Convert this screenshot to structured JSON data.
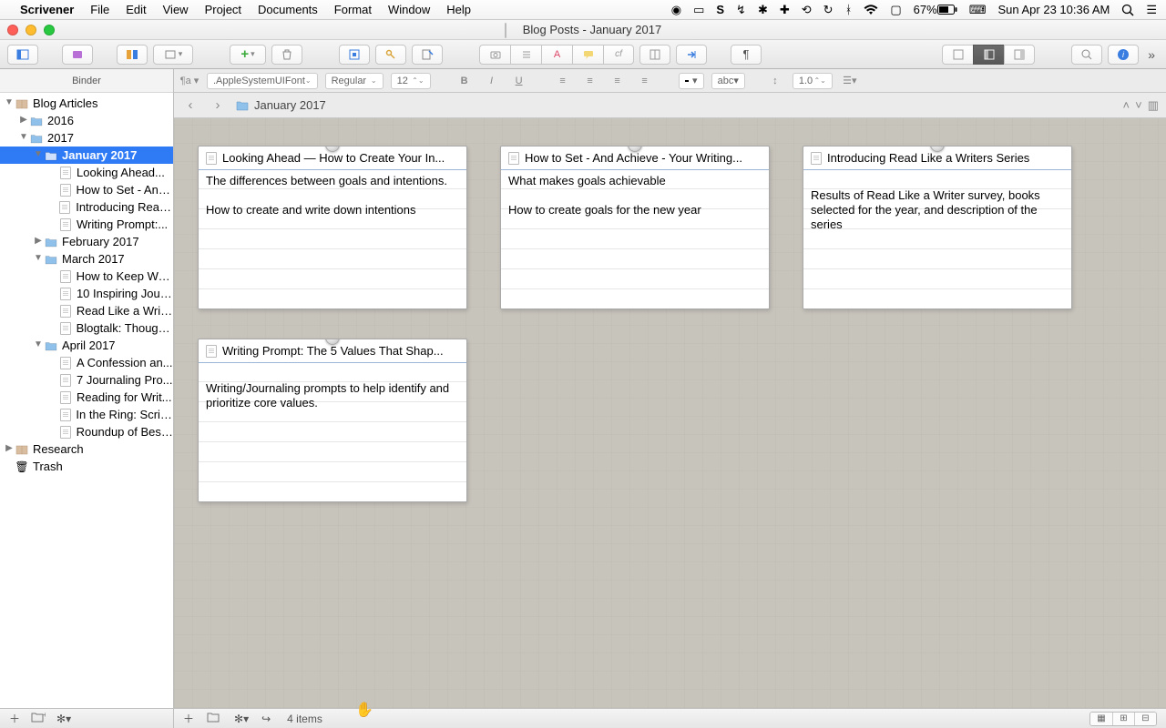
{
  "menubar": {
    "app": "Scrivener",
    "items": [
      "File",
      "Edit",
      "View",
      "Project",
      "Documents",
      "Format",
      "Window",
      "Help"
    ],
    "battery": "67%",
    "datetime": "Sun Apr 23  10:36 AM"
  },
  "window": {
    "title": "Blog Posts - January 2017"
  },
  "formatbar": {
    "font": ".AppleSystemUIFont",
    "style": "Regular",
    "size": "12",
    "spacing": "1.0"
  },
  "binder": {
    "header": "Binder",
    "tree": [
      {
        "type": "folder",
        "label": "Blog Articles",
        "depth": 0,
        "open": true,
        "icon": "box"
      },
      {
        "type": "folder",
        "label": "2016",
        "depth": 1,
        "open": false
      },
      {
        "type": "folder",
        "label": "2017",
        "depth": 1,
        "open": true
      },
      {
        "type": "folder",
        "label": "January 2017",
        "depth": 2,
        "open": true,
        "selected": true
      },
      {
        "type": "doc",
        "label": "Looking Ahead...",
        "depth": 3
      },
      {
        "type": "doc",
        "label": "How to Set - And...",
        "depth": 3
      },
      {
        "type": "doc",
        "label": "Introducing Read...",
        "depth": 3
      },
      {
        "type": "doc",
        "label": "Writing Prompt:...",
        "depth": 3
      },
      {
        "type": "folder",
        "label": "February 2017",
        "depth": 2,
        "open": false
      },
      {
        "type": "folder",
        "label": "March 2017",
        "depth": 2,
        "open": true
      },
      {
        "type": "doc",
        "label": "How to Keep Wri...",
        "depth": 3
      },
      {
        "type": "doc",
        "label": "10 Inspiring Jour...",
        "depth": 3
      },
      {
        "type": "doc",
        "label": "Read Like a Writ...",
        "depth": 3
      },
      {
        "type": "doc",
        "label": "Blogtalk: Though...",
        "depth": 3
      },
      {
        "type": "folder",
        "label": "April 2017",
        "depth": 2,
        "open": true
      },
      {
        "type": "doc",
        "label": "A Confession an...",
        "depth": 3
      },
      {
        "type": "doc",
        "label": "7 Journaling Pro...",
        "depth": 3
      },
      {
        "type": "doc",
        "label": "Reading for Writ...",
        "depth": 3
      },
      {
        "type": "doc",
        "label": "In the Ring: Scriv...",
        "depth": 3
      },
      {
        "type": "doc",
        "label": "Roundup of Best...",
        "depth": 3
      },
      {
        "type": "folder",
        "label": "Research",
        "depth": 0,
        "open": false,
        "icon": "box"
      },
      {
        "type": "trash",
        "label": "Trash",
        "depth": 0
      }
    ]
  },
  "pathbar": {
    "location": "January 2017"
  },
  "cards": [
    {
      "title": "Looking Ahead — How to Create Your In...",
      "body": "The differences between goals and intentions.\n\nHow to create and write down intentions"
    },
    {
      "title": "How to Set - And Achieve - Your Writing...",
      "body": "What makes goals achievable\n\nHow to create goals for the new year"
    },
    {
      "title": "Introducing Read Like a Writers Series",
      "body": "\nResults of Read Like a Writer survey, books selected for the year, and description of the series"
    },
    {
      "title": "Writing Prompt: The 5 Values That Shap...",
      "body": "\nWriting/Journaling prompts to help identify and prioritize core values."
    }
  ],
  "footer": {
    "status": "4 items"
  }
}
